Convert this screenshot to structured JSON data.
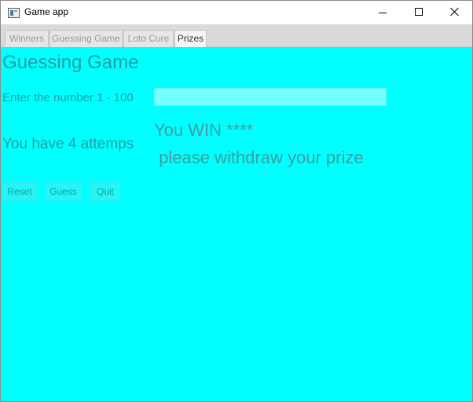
{
  "window": {
    "title": "Game app",
    "controls": {
      "minimize": "minimize",
      "maximize": "maximize",
      "close": "close"
    }
  },
  "tabs": [
    {
      "label": "Winners",
      "selected": false
    },
    {
      "label": "Guessing Game",
      "selected": false
    },
    {
      "label": "Loto Cure",
      "selected": false
    },
    {
      "label": "Prizes",
      "selected": true
    }
  ],
  "content": {
    "heading": "Guessing Game",
    "prompt_label": "Enter the number 1 - 100",
    "number_input": {
      "value": "",
      "placeholder": ""
    },
    "attempts_text": "You have 4 attemps",
    "result_line1": "You WIN ****",
    "result_line2": " please withdraw your prize",
    "buttons": {
      "reset": "Reset",
      "guess": "Guess",
      "quit": "Quit"
    }
  },
  "colors": {
    "content_background": "#00ffff",
    "text": "#1f9fa3",
    "result_text": "#3f9ea1",
    "input_background": "#75ffff",
    "tabbar_background": "#dadada"
  },
  "icons": {
    "app": "app-window-icon"
  }
}
